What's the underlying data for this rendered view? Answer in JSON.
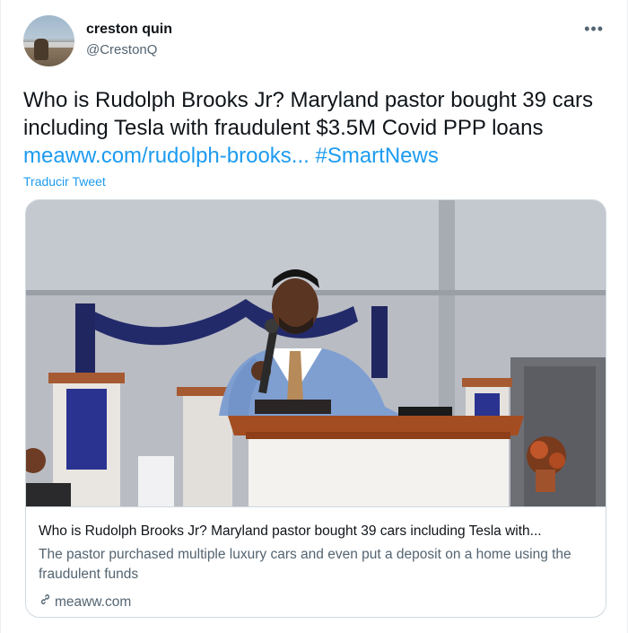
{
  "user": {
    "display_name": "creston quin",
    "handle": "@CrestonQ"
  },
  "more_label": "•••",
  "tweet": {
    "text_plain": "Who is Rudolph Brooks Jr? Maryland pastor bought 39 cars including Tesla with fraudulent $3.5M Covid PPP loans ",
    "link_text": "meaww.com/rudolph-brooks...",
    "hashtag": "#SmartNews",
    "translate_label": "Traducir Tweet"
  },
  "card": {
    "title": "Who is Rudolph Brooks Jr? Maryland pastor bought 39 cars including Tesla with...",
    "description": "The pastor purchased multiple luxury cars and even put a deposit on a home using the fraudulent funds",
    "domain": "meaww.com",
    "link_icon": "link-icon"
  },
  "colors": {
    "link": "#1d9bf0",
    "secondary_text": "#536471",
    "border": "#cfd9de"
  }
}
